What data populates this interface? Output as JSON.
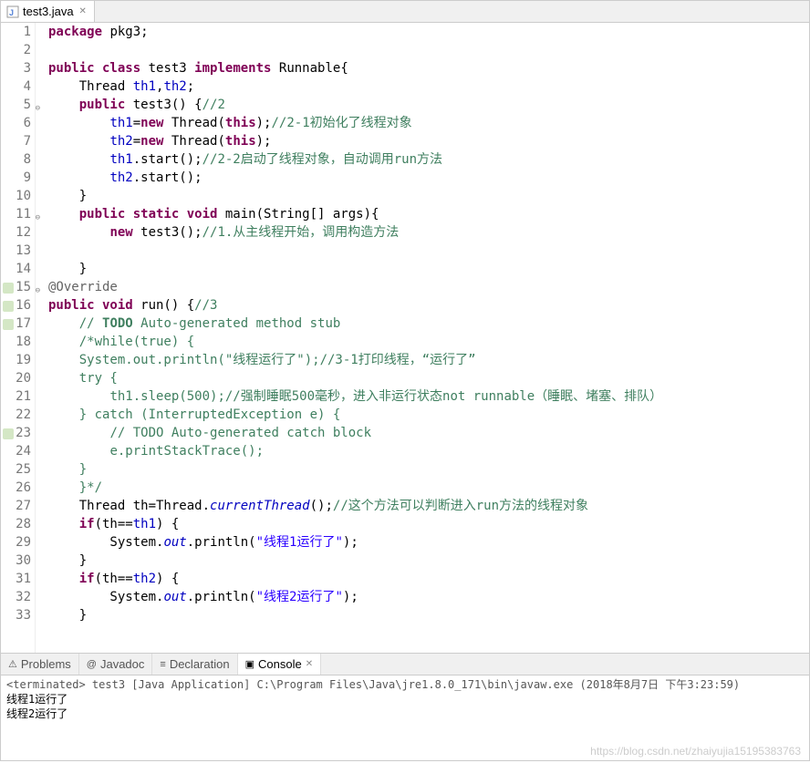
{
  "tab": {
    "filename": "test3.java"
  },
  "code": {
    "lines": [
      {
        "n": 1,
        "html": "<span class='kw'>package</span> pkg3;"
      },
      {
        "n": 2,
        "html": ""
      },
      {
        "n": 3,
        "html": "<span class='kw'>public class</span> test3 <span class='kw'>implements</span> Runnable{"
      },
      {
        "n": 4,
        "html": "    Thread <span class='fld'>th1</span>,<span class='fld'>th2</span>;"
      },
      {
        "n": 5,
        "fold": true,
        "html": "    <span class='kw'>public</span> test3() {<span class='cm'>//2</span>"
      },
      {
        "n": 6,
        "html": "        <span class='fld'>th1</span>=<span class='kw'>new</span> Thread(<span class='kw'>this</span>);<span class='cm'>//2-1初始化了线程对象</span>"
      },
      {
        "n": 7,
        "html": "        <span class='fld'>th2</span>=<span class='kw'>new</span> Thread(<span class='kw'>this</span>);"
      },
      {
        "n": 8,
        "html": "        <span class='fld'>th1</span>.start();<span class='cm'>//2-2启动了线程对象，自动调用run方法</span>"
      },
      {
        "n": 9,
        "html": "        <span class='fld'>th2</span>.start();"
      },
      {
        "n": 10,
        "html": "    }"
      },
      {
        "n": 11,
        "fold": true,
        "html": "    <span class='kw'>public static void</span> main(String[] args){"
      },
      {
        "n": 12,
        "html": "        <span class='kw'>new</span> test3();<span class='cm'>//1.从主线程开始，调用构造方法</span>"
      },
      {
        "n": 13,
        "html": ""
      },
      {
        "n": 14,
        "html": "    }"
      },
      {
        "n": 15,
        "fold": true,
        "ovr": true,
        "html": "<span class='an'>@Override</span>"
      },
      {
        "n": 16,
        "ovr": true,
        "html": "<span class='kw'>public void</span> run() {<span class='cm'>//3</span>"
      },
      {
        "n": 17,
        "ovr": true,
        "html": "    <span class='cm'>// <b>TODO</b> Auto-generated method stub</span>"
      },
      {
        "n": 18,
        "html": "    <span class='cm'>/*while(true) {</span>"
      },
      {
        "n": 19,
        "html": "    <span class='cm'>System.out.println(\"线程运行了\");//3-1打印线程，“运行了”</span>"
      },
      {
        "n": 20,
        "html": "    <span class='cm'>try {</span>"
      },
      {
        "n": 21,
        "html": "        <span class='cm'>th1.sleep(500);//强制睡眠500毫秒，进入非运行状态not runnable（睡眠、堵塞、排队）</span>"
      },
      {
        "n": 22,
        "html": "    <span class='cm'>} catch (InterruptedException e) {</span>"
      },
      {
        "n": 23,
        "ovr": true,
        "html": "        <span class='cm'>// TODO Auto-generated catch block</span>"
      },
      {
        "n": 24,
        "html": "        <span class='cm'>e.printStackTrace();</span>"
      },
      {
        "n": 25,
        "html": "    <span class='cm'>}</span>"
      },
      {
        "n": 26,
        "html": "    <span class='cm'>}*/</span>"
      },
      {
        "n": 27,
        "html": "    Thread th=Thread.<span class='sf'>currentThread</span>();<span class='cm'>//这个方法可以判断进入run方法的线程对象</span>"
      },
      {
        "n": 28,
        "html": "    <span class='kw'>if</span>(th==<span class='fld'>th1</span>) {"
      },
      {
        "n": 29,
        "html": "        System.<span class='sf'>out</span>.println(<span class='str'>\"线程1运行了\"</span>);"
      },
      {
        "n": 30,
        "html": "    }"
      },
      {
        "n": 31,
        "html": "    <span class='kw'>if</span>(th==<span class='fld'>th2</span>) {"
      },
      {
        "n": 32,
        "html": "        System.<span class='sf'>out</span>.println(<span class='str'>\"线程2运行了\"</span>);"
      },
      {
        "n": 33,
        "html": "    }"
      }
    ]
  },
  "bottom": {
    "tabs": [
      "Problems",
      "Javadoc",
      "Declaration",
      "Console"
    ],
    "active": 3,
    "terminated": "<terminated> test3 [Java Application] C:\\Program Files\\Java\\jre1.8.0_171\\bin\\javaw.exe (2018年8月7日 下午3:23:59)",
    "output": [
      "线程1运行了",
      "线程2运行了"
    ]
  },
  "watermark": "https://blog.csdn.net/zhaiyujia15195383763"
}
